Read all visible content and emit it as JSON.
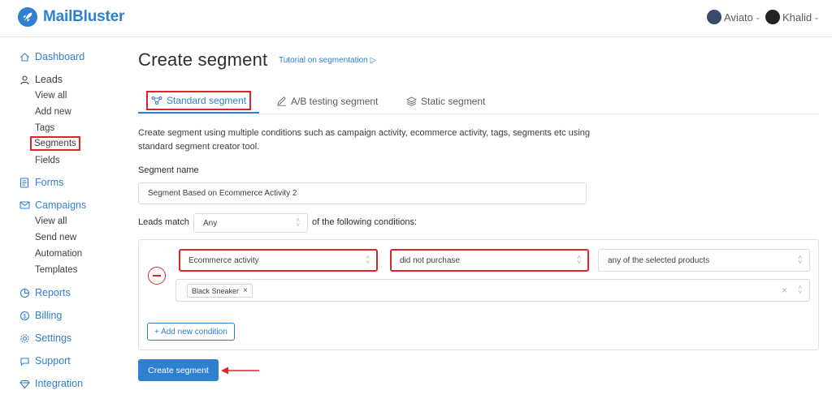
{
  "brand": {
    "name": "MailBluster",
    "color": "#2f80d1"
  },
  "accounts": [
    {
      "name": "Aviato",
      "icon": "org-avatar-icon"
    },
    {
      "name": "Khalid",
      "icon": "user-avatar-icon"
    }
  ],
  "sidebar": {
    "dashboard": "Dashboard",
    "leads": "Leads",
    "leads_items": [
      "View all",
      "Add new",
      "Tags",
      "Segments",
      "Fields"
    ],
    "forms": "Forms",
    "campaigns": "Campaigns",
    "campaigns_items": [
      "View all",
      "Send new",
      "Automation",
      "Templates"
    ],
    "reports": "Reports",
    "billing": "Billing",
    "settings": "Settings",
    "support": "Support",
    "integration": "Integration",
    "active_item": "Segments"
  },
  "page": {
    "title": "Create segment",
    "tutorial_link": "Tutorial on segmentation ▷"
  },
  "tabs": [
    {
      "label": "Standard segment",
      "icon": "network-icon",
      "active": true
    },
    {
      "label": "A/B testing segment",
      "icon": "pen-icon",
      "active": false
    },
    {
      "label": "Static segment",
      "icon": "layers-icon",
      "active": false
    }
  ],
  "description": "Create segment using multiple conditions such as campaign activity, ecommerce activity, tags, segments etc using standard segment creator tool.",
  "form": {
    "segment_name_label": "Segment name",
    "segment_name_value": "Segment Based on Ecommerce Activity 2",
    "leads_match_label": "Leads match",
    "leads_match_value": "Any",
    "leads_match_tail": "of the following conditions:"
  },
  "condition": {
    "field": "Ecommerce activity",
    "operator": "did not purchase",
    "target": "any of the selected products",
    "selected_tags": [
      "Black Sneaker"
    ]
  },
  "buttons": {
    "add_condition": "+ Add new condition",
    "create_segment": "Create segment"
  },
  "colors": {
    "accent": "#2f80d1",
    "highlight": "#d9262c",
    "danger": "#d9262c"
  }
}
